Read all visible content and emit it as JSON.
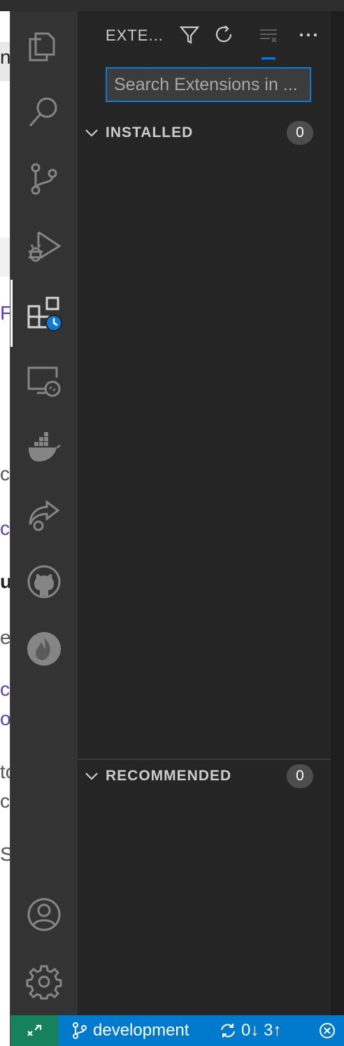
{
  "background": {
    "fragments": [
      "nc",
      "F",
      "ck",
      "cr",
      "ux",
      "e",
      "ct",
      "o",
      "to",
      "c",
      "St"
    ]
  },
  "activity_bar": {
    "items": [
      {
        "icon": "explorer-icon"
      },
      {
        "icon": "search-icon"
      },
      {
        "icon": "source-control-icon"
      },
      {
        "icon": "run-debug-icon"
      },
      {
        "icon": "extensions-icon",
        "active": true
      },
      {
        "icon": "remote-explorer-icon"
      },
      {
        "icon": "docker-icon"
      },
      {
        "icon": "live-share-icon"
      },
      {
        "icon": "github-icon"
      },
      {
        "icon": "firebase-icon"
      }
    ],
    "bottom": [
      {
        "icon": "accounts-icon"
      },
      {
        "icon": "manage-gear-icon"
      }
    ]
  },
  "sidebar": {
    "title": "EXTE...",
    "actions": [
      "filter-icon",
      "refresh-icon",
      "clear-extensions-input-icon",
      "more-actions-icon"
    ],
    "search": {
      "value": "",
      "placeholder": "Search Extensions in ..."
    },
    "sections": [
      {
        "label": "INSTALLED",
        "count": "0"
      },
      {
        "label": "RECOMMENDED",
        "count": "0"
      }
    ]
  },
  "statusbar": {
    "remote_icon": "remote-indicator-icon",
    "branch": "development",
    "sync": "0↓ 3↑"
  },
  "colors": {
    "activity_bar": "#333333",
    "sidebar": "#252526",
    "accent": "#007acc",
    "remote": "#16825d"
  }
}
